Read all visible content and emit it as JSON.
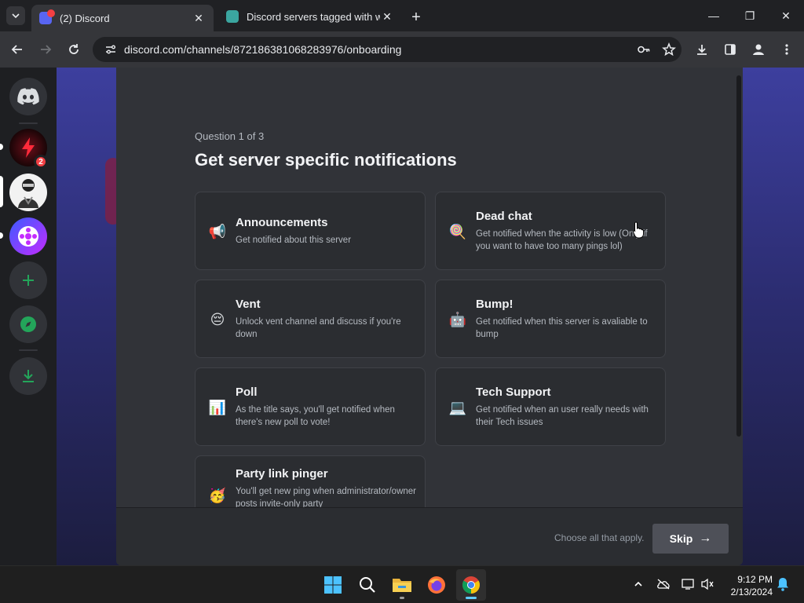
{
  "browser": {
    "tabs": [
      {
        "title": "(2) Discord",
        "active": true
      },
      {
        "title": "Discord servers tagged with wi",
        "active": false
      }
    ],
    "url": "discord.com/channels/872186381068283976/onboarding",
    "window_buttons": {
      "minimize": "—",
      "restore": "❐",
      "close": "✕"
    }
  },
  "guilds": [
    {
      "name": "discord-home",
      "badge": ""
    },
    {
      "name": "server-red-lightning",
      "badge": "2"
    },
    {
      "name": "server-character",
      "badge": ""
    },
    {
      "name": "server-film",
      "badge": ""
    },
    {
      "name": "add-server",
      "badge": ""
    },
    {
      "name": "explore",
      "badge": ""
    },
    {
      "name": "download-apps",
      "badge": ""
    }
  ],
  "onboarding": {
    "question_count": "Question 1 of 3",
    "title": "Get server specific notifications",
    "options": [
      {
        "emoji": "📢",
        "title": "Announcements",
        "desc": "Get notified about this server"
      },
      {
        "emoji": "🍭",
        "title": "Dead chat",
        "desc": "Get notified when the activity is low (Only if you want to have too many pings lol)"
      },
      {
        "emoji": "😔",
        "title": "Vent",
        "desc": "Unlock vent channel and discuss if you're down"
      },
      {
        "emoji": "🤖",
        "title": "Bump!",
        "desc": "Get notified when this server is avaliable to bump"
      },
      {
        "emoji": "📊",
        "title": "Poll",
        "desc": "As the title says, you'll get notified when there's new poll to vote!"
      },
      {
        "emoji": "💻",
        "title": "Tech Support",
        "desc": "Get notified when an user really needs with their Tech issues"
      },
      {
        "emoji": "🥳",
        "title": "Party link pinger",
        "desc": "You'll get new ping when administrator/owner posts invite-only party"
      }
    ],
    "footer_hint": "Choose all that apply.",
    "skip_label": "Skip",
    "skip_arrow": "→"
  },
  "taskbar": {
    "time": "9:12 PM",
    "date": "2/13/2024"
  },
  "colors": {
    "blurple": "#5865f2",
    "green": "#23a55a",
    "red": "#f23f43"
  }
}
